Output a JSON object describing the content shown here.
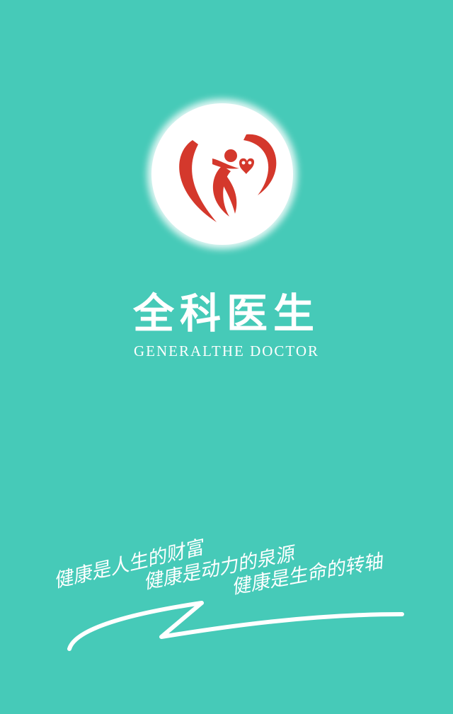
{
  "app": {
    "title": "全科医生",
    "subtitle": "GENERALTHE DOCTOR"
  },
  "logo": {
    "icon": "heart-figure-logo-icon",
    "colors": {
      "primary_red": "#d4382c",
      "circle": "#ffffff"
    }
  },
  "slogans": [
    "健康是人生的财富",
    "健康是动力的泉源",
    "健康是生命的转轴"
  ],
  "theme": {
    "background": "#46cab8",
    "text": "#ffffff"
  }
}
